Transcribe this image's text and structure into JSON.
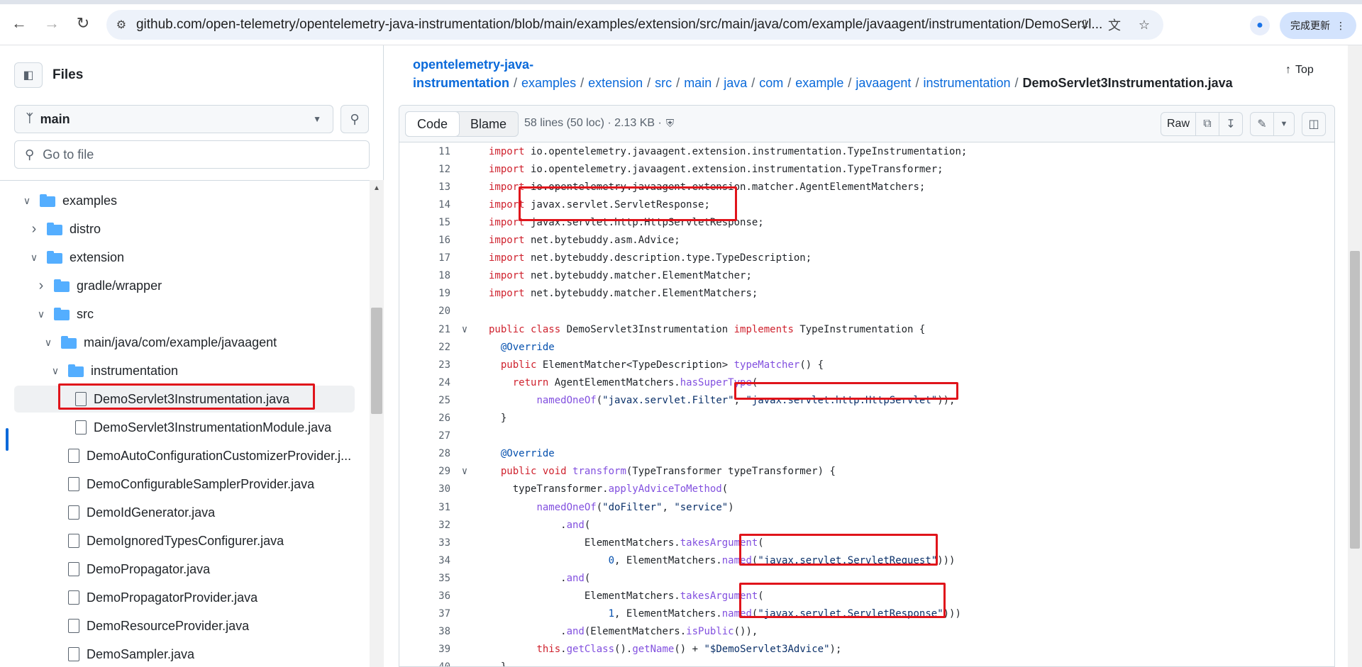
{
  "browser": {
    "url": "github.com/open-telemetry/opentelemetry-java-instrumentation/blob/main/examples/extension/src/main/java/com/example/javaagent/instrumentation/DemoServl...",
    "update_label": "完成更新"
  },
  "sidebar": {
    "title": "Files",
    "branch": "main",
    "goto_placeholder": "Go to file",
    "tree": [
      {
        "label": "examples",
        "type": "folder",
        "depth": 0,
        "expanded": true
      },
      {
        "label": "distro",
        "type": "folder",
        "depth": 1,
        "expanded": false
      },
      {
        "label": "extension",
        "type": "folder",
        "depth": 1,
        "expanded": true
      },
      {
        "label": "gradle/wrapper",
        "type": "folder",
        "depth": 2,
        "expanded": false
      },
      {
        "label": "src",
        "type": "folder",
        "depth": 2,
        "expanded": true
      },
      {
        "label": "main/java/com/example/javaagent",
        "type": "folder",
        "depth": 3,
        "expanded": true
      },
      {
        "label": "instrumentation",
        "type": "folder",
        "depth": 4,
        "expanded": true
      },
      {
        "label": "DemoServlet3Instrumentation.java",
        "type": "file",
        "depth": 5,
        "selected": true
      },
      {
        "label": "DemoServlet3InstrumentationModule.java",
        "type": "file",
        "depth": 5
      },
      {
        "label": "DemoAutoConfigurationCustomizerProvider.j...",
        "type": "file",
        "depth": 4
      },
      {
        "label": "DemoConfigurableSamplerProvider.java",
        "type": "file",
        "depth": 4
      },
      {
        "label": "DemoIdGenerator.java",
        "type": "file",
        "depth": 4
      },
      {
        "label": "DemoIgnoredTypesConfigurer.java",
        "type": "file",
        "depth": 4
      },
      {
        "label": "DemoPropagator.java",
        "type": "file",
        "depth": 4
      },
      {
        "label": "DemoPropagatorProvider.java",
        "type": "file",
        "depth": 4
      },
      {
        "label": "DemoResourceProvider.java",
        "type": "file",
        "depth": 4
      },
      {
        "label": "DemoSampler.java",
        "type": "file",
        "depth": 4
      }
    ]
  },
  "breadcrumb": {
    "parts": [
      "opentelemetry-java-instrumentation",
      "examples",
      "extension",
      "src",
      "main",
      "java",
      "com",
      "example",
      "javaagent",
      "instrumentation"
    ],
    "current": "DemoServlet3Instrumentation.java"
  },
  "top_label": "Top",
  "file": {
    "tab_code": "Code",
    "tab_blame": "Blame",
    "meta": "58 lines (50 loc) · 2.13 KB ·",
    "raw_label": "Raw"
  },
  "code_lines": [
    {
      "n": "11",
      "tokens": [
        [
          "kw",
          "import"
        ],
        [
          "src",
          " io.opentelemetry.javaagent.extension.instrumentation.TypeInstrumentation;"
        ]
      ]
    },
    {
      "n": "12",
      "tokens": [
        [
          "kw",
          "import"
        ],
        [
          "src",
          " io.opentelemetry.javaagent.extension.instrumentation.TypeTransformer;"
        ]
      ]
    },
    {
      "n": "13",
      "tokens": [
        [
          "kw",
          "import"
        ],
        [
          "src",
          " io.opentelemetry.javaagent.extension.matcher.AgentElementMatchers;"
        ]
      ]
    },
    {
      "n": "14",
      "tokens": [
        [
          "kw",
          "import"
        ],
        [
          "src",
          " javax.servlet.ServletResponse;"
        ]
      ]
    },
    {
      "n": "15",
      "tokens": [
        [
          "kw",
          "import"
        ],
        [
          "src",
          " javax.servlet.http.HttpServletResponse;"
        ]
      ]
    },
    {
      "n": "16",
      "tokens": [
        [
          "kw",
          "import"
        ],
        [
          "src",
          " net.bytebuddy.asm.Advice;"
        ]
      ]
    },
    {
      "n": "17",
      "tokens": [
        [
          "kw",
          "import"
        ],
        [
          "src",
          " net.bytebuddy.description.type.TypeDescription;"
        ]
      ]
    },
    {
      "n": "18",
      "tokens": [
        [
          "kw",
          "import"
        ],
        [
          "src",
          " net.bytebuddy.matcher.ElementMatcher;"
        ]
      ]
    },
    {
      "n": "19",
      "tokens": [
        [
          "kw",
          "import"
        ],
        [
          "src",
          " net.bytebuddy.matcher.ElementMatchers;"
        ]
      ]
    },
    {
      "n": "20",
      "tokens": []
    },
    {
      "n": "21",
      "fold": true,
      "tokens": [
        [
          "kw",
          "public class"
        ],
        [
          "src",
          " DemoServlet3Instrumentation "
        ],
        [
          "kw",
          "implements"
        ],
        [
          "src",
          " TypeInstrumentation {"
        ]
      ]
    },
    {
      "n": "22",
      "tokens": [
        [
          "src",
          "  "
        ],
        [
          "ann",
          "@Override"
        ]
      ]
    },
    {
      "n": "23",
      "tokens": [
        [
          "kw",
          "  public"
        ],
        [
          "src",
          " ElementMatcher<TypeDescription> "
        ],
        [
          "fn",
          "typeMatcher"
        ],
        [
          "src",
          "() {"
        ]
      ]
    },
    {
      "n": "24",
      "tokens": [
        [
          "kw",
          "    return"
        ],
        [
          "src",
          " AgentElementMatchers."
        ],
        [
          "fn",
          "hasSuperType"
        ],
        [
          "src",
          "("
        ]
      ]
    },
    {
      "n": "25",
      "tokens": [
        [
          "src",
          "        "
        ],
        [
          "fn",
          "namedOneOf"
        ],
        [
          "src",
          "("
        ],
        [
          "str",
          "\"javax.servlet.Filter\""
        ],
        [
          "src",
          ", "
        ],
        [
          "str",
          "\"javax.servlet.http.HttpServlet\""
        ],
        [
          "src",
          "));"
        ]
      ]
    },
    {
      "n": "26",
      "tokens": [
        [
          "src",
          "  }"
        ]
      ]
    },
    {
      "n": "27",
      "tokens": []
    },
    {
      "n": "28",
      "tokens": [
        [
          "src",
          "  "
        ],
        [
          "ann",
          "@Override"
        ]
      ]
    },
    {
      "n": "29",
      "fold": true,
      "tokens": [
        [
          "kw",
          "  public void"
        ],
        [
          "src",
          " "
        ],
        [
          "fn",
          "transform"
        ],
        [
          "src",
          "(TypeTransformer typeTransformer) {"
        ]
      ]
    },
    {
      "n": "30",
      "tokens": [
        [
          "src",
          "    typeTransformer."
        ],
        [
          "fn",
          "applyAdviceToMethod"
        ],
        [
          "src",
          "("
        ]
      ]
    },
    {
      "n": "31",
      "tokens": [
        [
          "src",
          "        "
        ],
        [
          "fn",
          "namedOneOf"
        ],
        [
          "src",
          "("
        ],
        [
          "str",
          "\"doFilter\""
        ],
        [
          "src",
          ", "
        ],
        [
          "str",
          "\"service\""
        ],
        [
          "src",
          ")"
        ]
      ]
    },
    {
      "n": "32",
      "tokens": [
        [
          "src",
          "            ."
        ],
        [
          "fn",
          "and"
        ],
        [
          "src",
          "("
        ]
      ]
    },
    {
      "n": "33",
      "tokens": [
        [
          "src",
          "                ElementMatchers."
        ],
        [
          "fn",
          "takesArgument"
        ],
        [
          "src",
          "("
        ]
      ]
    },
    {
      "n": "34",
      "tokens": [
        [
          "src",
          "                    "
        ],
        [
          "num",
          "0"
        ],
        [
          "src",
          ", ElementMatchers."
        ],
        [
          "fn",
          "named"
        ],
        [
          "src",
          "("
        ],
        [
          "str",
          "\"javax.servlet.ServletRequest\""
        ],
        [
          "src",
          ")))"
        ]
      ]
    },
    {
      "n": "35",
      "tokens": [
        [
          "src",
          "            ."
        ],
        [
          "fn",
          "and"
        ],
        [
          "src",
          "("
        ]
      ]
    },
    {
      "n": "36",
      "tokens": [
        [
          "src",
          "                ElementMatchers."
        ],
        [
          "fn",
          "takesArgument"
        ],
        [
          "src",
          "("
        ]
      ]
    },
    {
      "n": "37",
      "tokens": [
        [
          "src",
          "                    "
        ],
        [
          "num",
          "1"
        ],
        [
          "src",
          ", ElementMatchers."
        ],
        [
          "fn",
          "named"
        ],
        [
          "src",
          "("
        ],
        [
          "str",
          "\"javax.servlet.ServletResponse\""
        ],
        [
          "src",
          ")))"
        ]
      ]
    },
    {
      "n": "38",
      "tokens": [
        [
          "src",
          "            ."
        ],
        [
          "fn",
          "and"
        ],
        [
          "src",
          "(ElementMatchers."
        ],
        [
          "fn",
          "isPublic"
        ],
        [
          "src",
          "()),"
        ]
      ]
    },
    {
      "n": "39",
      "tokens": [
        [
          "src",
          "        "
        ],
        [
          "kw",
          "this"
        ],
        [
          "src",
          "."
        ],
        [
          "fn",
          "getClass"
        ],
        [
          "src",
          "()."
        ],
        [
          "fn",
          "getName"
        ],
        [
          "src",
          "() + "
        ],
        [
          "str",
          "\"$DemoServlet3Advice\""
        ],
        [
          "src",
          ");"
        ]
      ]
    },
    {
      "n": "40",
      "tokens": [
        [
          "src",
          "  }"
        ]
      ]
    }
  ],
  "colors": {
    "link": "#0969da",
    "highlight": "#e0141b",
    "folder": "#54aeff"
  }
}
